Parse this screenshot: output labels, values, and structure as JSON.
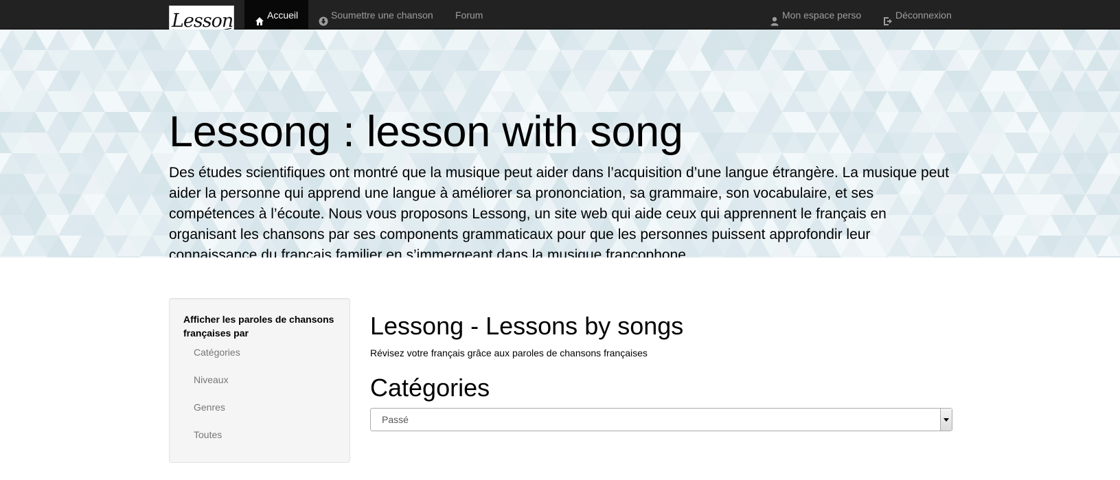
{
  "navbar": {
    "logo_text": "Lessong",
    "items": [
      {
        "label": "Accueil",
        "icon": "home-icon",
        "active": true
      },
      {
        "label": "Soumettre une chanson",
        "icon": "circle-arrow-down-icon",
        "active": false
      },
      {
        "label": "Forum",
        "icon": "",
        "active": false
      }
    ],
    "right_items": [
      {
        "label": "Mon espace perso",
        "icon": "user-icon"
      },
      {
        "label": "Déconnexion",
        "icon": "logout-icon"
      }
    ]
  },
  "hero": {
    "title": "Lessong : lesson with song",
    "text": "Des études scientifiques ont montré que la musique peut aider dans l’acquisition d’une langue étrangère. La musique peut aider la personne qui apprend une langue à améliorer sa prononciation, sa grammaire, son vocabulaire, et ses compétences à l’écoute. Nous vous proposons Lessong, un site web qui aide ceux qui apprennent le français en organisant les chansons par ses components grammaticaux pour que les personnes puissent approfondir leur connaissance du français familier en s’immergeant dans la musique francophone."
  },
  "sidebar": {
    "heading": "Afficher les paroles de chansons françaises par",
    "links": [
      {
        "label": "Catégories"
      },
      {
        "label": "Niveaux"
      },
      {
        "label": "Genres"
      },
      {
        "label": "Toutes"
      }
    ]
  },
  "main": {
    "title": "Lessong - Lessons by songs",
    "subtitle": "Révisez votre français grâce aux paroles de chansons françaises",
    "section_title": "Catégories",
    "select_value": "Passé"
  },
  "colors": {
    "navbar_bg": "#222222",
    "nav_active_bg": "#080808",
    "nav_text": "#9d9d9d",
    "hero_bg": "#e4eef2",
    "sidebar_bg": "#f5f5f5"
  }
}
